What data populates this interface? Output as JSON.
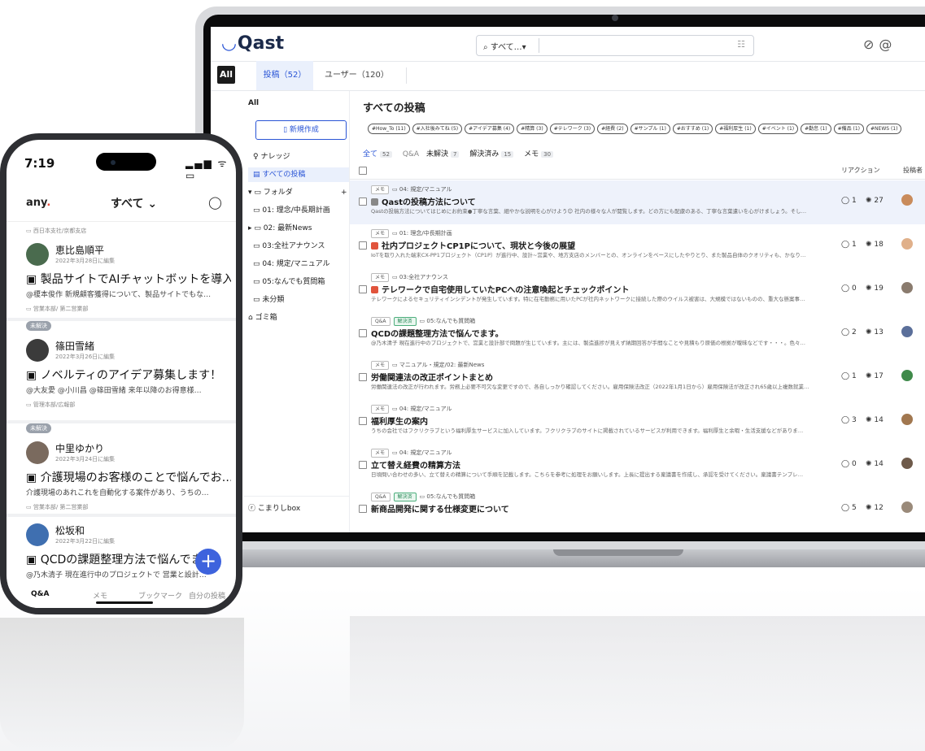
{
  "laptop": {
    "app_name": "Qast",
    "search": {
      "scope": "すべて…▾"
    },
    "tabs": {
      "all": "All",
      "posts": "投稿（52）",
      "users": "ユーザー（120）"
    },
    "sidebar": {
      "all": "All",
      "new_post": "新規作成",
      "items": [
        {
          "label": "ナレッジ",
          "icon": "bulb-icon"
        },
        {
          "label": "すべての投稿",
          "icon": "doc-icon"
        },
        {
          "label": "フォルダ",
          "icon": "folder-icon"
        },
        {
          "label": "01: 理念/中長期計画",
          "icon": "folder-icon"
        },
        {
          "label": "02: 最新News",
          "icon": "folder-icon"
        },
        {
          "label": "03:全社アナウンス",
          "icon": "folder-icon"
        },
        {
          "label": "04: 規定/マニュアル",
          "icon": "folder-icon"
        },
        {
          "label": "05:なんでも質問箱",
          "icon": "folder-icon"
        },
        {
          "label": "未分類",
          "icon": "folder-icon"
        },
        {
          "label": "ゴミ箱",
          "icon": "trash-icon"
        }
      ],
      "folder_add": "+",
      "bottom": "こまりしbox"
    },
    "main": {
      "title": "すべての投稿",
      "tags": [
        "#How_To (11)",
        "#入社後みてね (5)",
        "#アイデア募集 (4)",
        "#精算 (3)",
        "#テレワーク (3)",
        "#経費 (2)",
        "#サンプル (1)",
        "#おすすめ (1)",
        "#福利厚生 (1)",
        "#イベント (1)",
        "#勤怠 (1)",
        "#備品 (1)",
        "#NEWS (1)"
      ],
      "filters": [
        {
          "label": "全て",
          "count": "52"
        },
        {
          "label": "Q&A",
          "count": ""
        },
        {
          "label": "未解決",
          "count": "7"
        },
        {
          "label": "解決済み",
          "count": "15"
        },
        {
          "label": "メモ",
          "count": "30"
        }
      ],
      "header": {
        "reaction": "リアクション",
        "author": "投稿者"
      },
      "posts": [
        {
          "badges": [
            "メモ"
          ],
          "path": "04: 規定/マニュアル",
          "title": "Qastの投稿方法について",
          "excerpt": "Qastの投稿方法についてはじめにお約束●丁寧な言葉、細やかな説明を心がけよう😊 社内の様々な人が閲覧します。どの方にも配慮のある、丁寧な言葉遣いを心がけましょう。そし…",
          "comments": "1",
          "likes": "27",
          "icon_color": "#888888",
          "avatar_color": "#c98b5b"
        },
        {
          "badges": [
            "メモ"
          ],
          "path": "01: 理念/中長期計画",
          "title": "社内プロジェクトCP1Pについて、現状と今後の展望",
          "excerpt": "IoTを取り入れた端末CX-PP1プロジェクト（CP1P）が進行中、設計~営業や、地方支店のメンバーとの、オンラインをベースにしたやりとり、また製品自体のクオリティも、かなり…",
          "comments": "1",
          "likes": "18",
          "icon_color": "#e1543c",
          "avatar_color": "#e0b08a"
        },
        {
          "badges": [
            "メモ"
          ],
          "path": "03:全社アナウンス",
          "title": "テレワークで自宅使用していたPCへの注意喚起とチェックポイント",
          "excerpt": "テレワークによるセキュリティインシデントが発生しています。特に在宅勤務に用いたPCが社内ネットワークに接続した際のウイルス被害は、大規模ではないものの、重大な懸案事…",
          "comments": "0",
          "likes": "19",
          "icon_color": "#e1543c",
          "avatar_color": "#8a7b6e"
        },
        {
          "badges": [
            "Q&A",
            "解決済"
          ],
          "path": "05:なんでも質問箱",
          "title": "QCDの課題整理方法で悩んでます。",
          "excerpt": "@乃木清子 現在進行中のプロジェクトで、営業と設計部で問題が生じています。主には、製造進捗が見えず納期回答が手間なことや見積もり原価の根拠が曖昧などです・・・。色々…",
          "comments": "2",
          "likes": "13",
          "icon_color": "",
          "avatar_color": "#5b6f9a"
        },
        {
          "badges": [
            "メモ"
          ],
          "path": "マニュアル・規定/02: 最新News",
          "title": "労働関連法の改正ポイントまとめ",
          "excerpt": "労働関連法の改正が行われます。労務上必要不可欠な変更ですので、各自しっかり確認してください。雇用保険法改正（2022年1月1日から）雇用保険法が改正され65歳以上複数就業…",
          "comments": "1",
          "likes": "17",
          "icon_color": "",
          "avatar_color": "#3f8a4a"
        },
        {
          "badges": [
            "メモ"
          ],
          "path": "04: 規定/マニュアル",
          "title": "福利厚生の案内",
          "excerpt": "うちの会社ではフクリクラブという福利厚生サービスに加入しています。フクリクラブのサイトに掲載されているサービスが利用できます。福利厚生と余暇・生活支援などがありま…",
          "comments": "3",
          "likes": "14",
          "icon_color": "",
          "avatar_color": "#a1774f"
        },
        {
          "badges": [
            "メモ"
          ],
          "path": "04: 規定/マニュアル",
          "title": "立て替え経費の精算方法",
          "excerpt": "日頃問い合わせの多い、立て替えの精算について手順を記載します。こちらを参考に処理をお願いします。上長に提出する稟議書を作成し、承認を受けてください。稟議書テンプレ…",
          "comments": "0",
          "likes": "14",
          "icon_color": "",
          "avatar_color": "#6e5a4a"
        },
        {
          "badges": [
            "Q&A",
            "解決済"
          ],
          "path": "05:なんでも質問箱",
          "title": "新商品開発に関する仕様変更について",
          "excerpt": "",
          "comments": "5",
          "likes": "12",
          "icon_color": "",
          "avatar_color": "#9a8a7a"
        }
      ]
    }
  },
  "phone": {
    "time": "7:19",
    "status": "▂▄▆ ᯤ ▭",
    "logo": "any",
    "logo_dot": ".",
    "scope": "すべて ⌄",
    "feed": [
      {
        "path": "西日本支社/京都支店",
        "badge": "",
        "name": "恵比島順平",
        "date": "2022年3月28日に編集",
        "title": "製品サイトでAIチャットボットを導入…",
        "excerpt": "@榎本俊作 新規顧客獲得について、製品サイトでもな…",
        "footer": "営業本部/ 第二営業部",
        "avatar_color": "#4a6b4e"
      },
      {
        "path": "",
        "badge": "未解決",
        "name": "篠田雪緒",
        "date": "2022年3月26日に編集",
        "title": "ノベルティのアイデア募集します！",
        "excerpt": "@大友愛 @小川昌 @篠田雪緒 来年以降のお得意様…",
        "footer": "管理本部/広報部",
        "avatar_color": "#3b3b3b"
      },
      {
        "path": "",
        "badge": "未解決",
        "name": "中里ゆかり",
        "date": "2022年3月24日に編集",
        "title": "介護現場のお客様のことで悩んでお…",
        "excerpt": "介護現場のあれこれを自動化する案件があり、うちの…",
        "footer": "営業本部/ 第二営業部",
        "avatar_color": "#7a6a5e"
      },
      {
        "path": "",
        "badge": "",
        "name": "松坂和",
        "date": "2022年3月22日に編集",
        "title": "QCDの課題整理方法で悩んでます。",
        "excerpt": "@乃木清子 現在進行中のプロジェクトで 営業と設計…",
        "footer": "",
        "avatar_color": "#3f6fb0"
      }
    ],
    "bottom_nav": [
      "Q&A",
      "メモ",
      "ブックマーク",
      "自分の投稿"
    ]
  }
}
